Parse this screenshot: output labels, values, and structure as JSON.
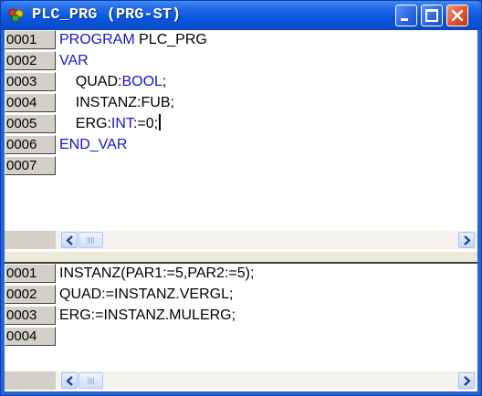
{
  "window": {
    "title": "PLC_PRG (PRG-ST)",
    "icon": "plc-program-icon",
    "colors": {
      "titlebar": "#0857e0",
      "close_button": "#e0532c",
      "keyword": "#1515cc"
    }
  },
  "title_buttons": {
    "minimize": "minimize",
    "maximize": "maximize",
    "close": "close"
  },
  "declaration_pane": {
    "lines": [
      {
        "num": "0001",
        "indent": "",
        "parts": [
          {
            "text": "PROGRAM",
            "kw": true
          },
          {
            "text": " PLC_PRG",
            "kw": false
          }
        ]
      },
      {
        "num": "0002",
        "indent": "",
        "parts": [
          {
            "text": "VAR",
            "kw": true
          }
        ]
      },
      {
        "num": "0003",
        "indent": "    ",
        "parts": [
          {
            "text": "QUAD:",
            "kw": false
          },
          {
            "text": "BOOL",
            "kw": true
          },
          {
            "text": ";",
            "kw": false
          }
        ]
      },
      {
        "num": "0004",
        "indent": "    ",
        "parts": [
          {
            "text": "INSTANZ:FUB;",
            "kw": false
          }
        ]
      },
      {
        "num": "0005",
        "indent": "    ",
        "parts": [
          {
            "text": "ERG:",
            "kw": false
          },
          {
            "text": "INT",
            "kw": true
          },
          {
            "text": ":=0;",
            "kw": false
          }
        ],
        "caret": true
      },
      {
        "num": "0006",
        "indent": "",
        "parts": [
          {
            "text": "END_VAR",
            "kw": true
          }
        ]
      },
      {
        "num": "0007",
        "indent": "",
        "parts": []
      }
    ]
  },
  "body_pane": {
    "lines": [
      {
        "num": "0001",
        "indent": "",
        "parts": [
          {
            "text": "INSTANZ(PAR1:=5,PAR2:=5);",
            "kw": false
          }
        ]
      },
      {
        "num": "0002",
        "indent": "",
        "parts": [
          {
            "text": "QUAD:=INSTANZ.VERGL;",
            "kw": false
          }
        ]
      },
      {
        "num": "0003",
        "indent": "",
        "parts": [
          {
            "text": "ERG:=INSTANZ.MULERG;",
            "kw": false
          }
        ]
      },
      {
        "num": "0004",
        "indent": "",
        "parts": []
      }
    ]
  }
}
